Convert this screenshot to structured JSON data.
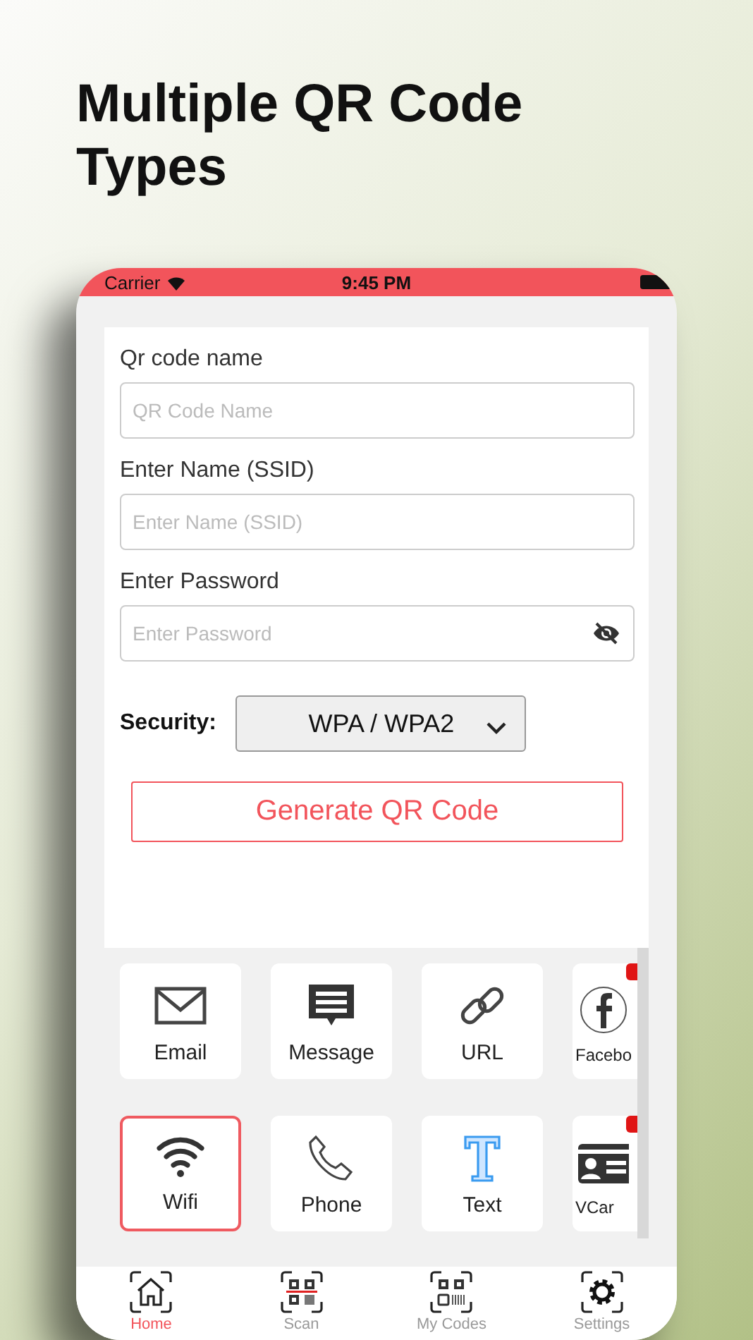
{
  "headline": "Multiple QR Code Types",
  "status_bar": {
    "carrier": "Carrier",
    "time": "9:45 PM"
  },
  "form": {
    "fields": [
      {
        "label": "Qr code name",
        "placeholder": "QR Code Name",
        "kind": "text"
      },
      {
        "label": "Enter Name (SSID)",
        "placeholder": "Enter Name (SSID)",
        "kind": "text"
      },
      {
        "label": "Enter Password",
        "placeholder": "Enter Password",
        "kind": "password"
      }
    ],
    "security": {
      "label": "Security:",
      "value": "WPA / WPA2"
    },
    "generate_button": "Generate QR Code"
  },
  "types": [
    {
      "label": "Email",
      "kind": "email",
      "selected": false,
      "badge": false
    },
    {
      "label": "Message",
      "kind": "message",
      "selected": false,
      "badge": false
    },
    {
      "label": "URL",
      "kind": "link",
      "selected": false,
      "badge": false
    },
    {
      "label": "Facebo",
      "kind": "facebook",
      "selected": false,
      "badge": true
    },
    {
      "label": "Wifi",
      "kind": "wifi",
      "selected": true,
      "badge": false
    },
    {
      "label": "Phone",
      "kind": "phone",
      "selected": false,
      "badge": false
    },
    {
      "label": "Text",
      "kind": "text",
      "selected": false,
      "badge": false
    },
    {
      "label": "VCar",
      "kind": "vcard",
      "selected": false,
      "badge": true
    }
  ],
  "tab_bar": [
    {
      "label": "Home",
      "kind": "home",
      "selected": true
    },
    {
      "label": "Scan",
      "kind": "scan",
      "selected": false
    },
    {
      "label": "My Codes",
      "kind": "codes",
      "selected": false
    },
    {
      "label": "Settings",
      "kind": "settings",
      "selected": false
    }
  ]
}
